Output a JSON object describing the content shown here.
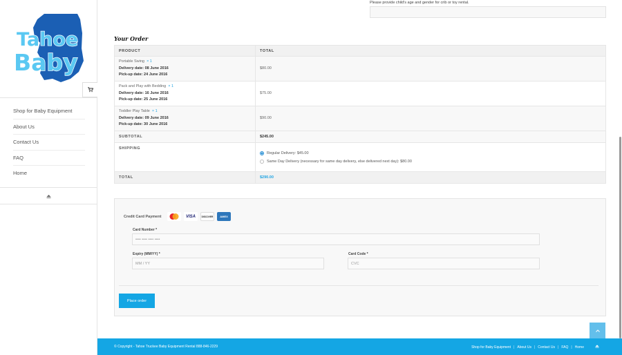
{
  "brand": {
    "logo_line1": "Tahoe",
    "logo_line2": "Baby"
  },
  "sidebar": {
    "items": [
      {
        "label": "Shop for Baby Equipment"
      },
      {
        "label": "About Us"
      },
      {
        "label": "Contact Us"
      },
      {
        "label": "FAQ"
      },
      {
        "label": "Home"
      }
    ]
  },
  "notes": {
    "label": "Please provide child's age and gender for crib or toy rental."
  },
  "order": {
    "title": "Your Order",
    "headers": {
      "product": "PRODUCT",
      "total": "TOTAL"
    },
    "items": [
      {
        "name": "Portable Swing",
        "qty": "× 1",
        "delivery": "Delivery date: 08 June 2016",
        "pickup": "Pick-up date: 24 June 2016",
        "price": "$80.00"
      },
      {
        "name": "Pack and Play with Bedding",
        "qty": "× 1",
        "delivery": "Delivery date: 16 June 2016",
        "pickup": "Pick-up date: 25 June 2016",
        "price": "$75.00"
      },
      {
        "name": "Toddler Play Table",
        "qty": "× 1",
        "delivery": "Delivery date: 09 June 2016",
        "pickup": "Pick-up date: 30 June 2016",
        "price": "$90.00"
      }
    ],
    "subtotal_label": "SUBTOTAL",
    "subtotal": "$245.00",
    "shipping_label": "SHIPPING",
    "shipping_options": [
      {
        "label": "Regular Delivery: $45.00",
        "selected": true
      },
      {
        "label": "Same Day Delivery (necessary for same day delivery, else delivered next day): $80.00",
        "selected": false
      }
    ],
    "total_label": "TOTAL",
    "total": "$290.00"
  },
  "payment": {
    "method_label": "Credit Card Payment",
    "cards": [
      "mastercard-icon",
      "visa-icon",
      "discover-icon",
      "amex-icon"
    ],
    "card_visa_text": "VISA",
    "card_discover_text": "DISCOVER",
    "card_amex_text": "AMEX",
    "card_number_label": "Card Number",
    "card_number_placeholder": "•••• •••• •••• ••••",
    "expiry_label": "Expiry (MM/YY)",
    "expiry_placeholder": "MM / YY",
    "cvc_label": "Card Code",
    "cvc_placeholder": "CVC",
    "required_mark": "*",
    "place_order": "Place order"
  },
  "footer": {
    "copyright": "© Copyright - Tahoe Truckee Baby Equipment Rental 888-846-2229",
    "links": [
      "Shop for Baby Equipment",
      "About Us",
      "Contact Us",
      "FAQ",
      "Home"
    ],
    "separator": "|"
  },
  "colors": {
    "accent": "#14a6e4",
    "logo_blue": "#1b5fb4",
    "logo_text": "#5ac8f2"
  }
}
